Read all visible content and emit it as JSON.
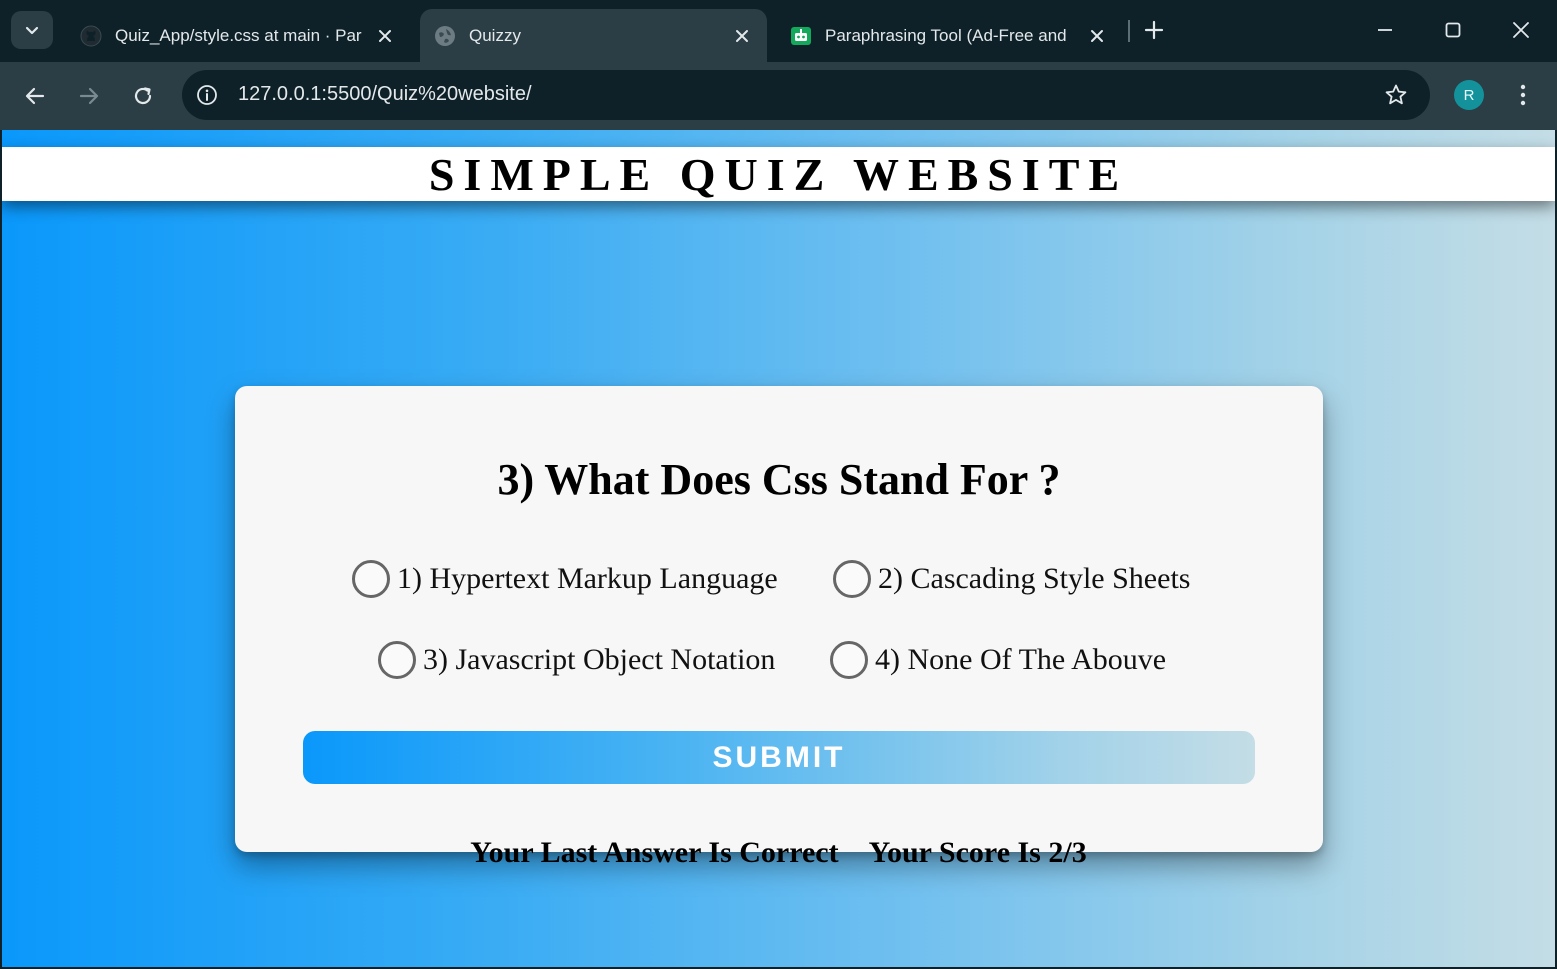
{
  "browser": {
    "tabs": [
      {
        "title": "Quiz_App/style.css at main · Par",
        "favicon": "github-icon",
        "active": false
      },
      {
        "title": "Quizzy",
        "favicon": "globe-icon",
        "active": true
      },
      {
        "title": "Paraphrasing Tool (Ad-Free and",
        "favicon": "robot-icon",
        "active": false
      }
    ],
    "address_bar": {
      "url": "127.0.0.1:5500/Quiz%20website/"
    },
    "profile_initial": "R",
    "colors": {
      "frame": "#0e2129",
      "toolbar": "#2b3d45",
      "avatar": "#13929c"
    }
  },
  "page": {
    "header_title": "SIMPLE QUIZ WEBSITE",
    "question": "3) What Does Css Stand For ?",
    "options": [
      "1) Hypertext Markup Language",
      "2) Cascading Style Sheets",
      "3) Javascript Object Notation",
      "4) None Of The Abouve"
    ],
    "submit_label": "SUBMIT",
    "result_message": "Your Last Answer Is Correct",
    "score_message": "Your Score Is 2/3",
    "colors": {
      "gradient_start": "#0a98fb",
      "gradient_end": "#c4dde6",
      "card": "#f7f7f7"
    }
  }
}
